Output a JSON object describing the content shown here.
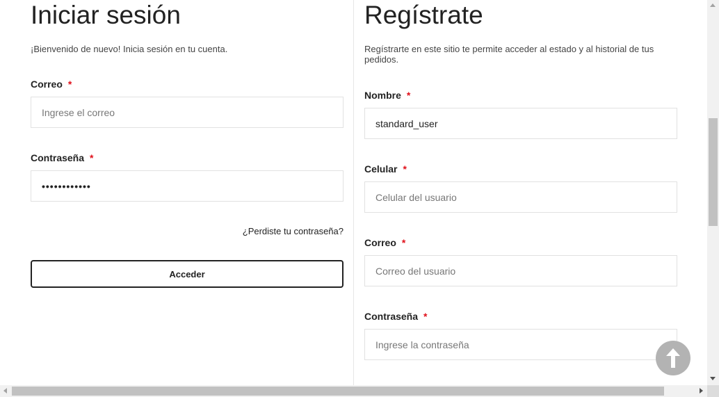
{
  "login": {
    "title": "Iniciar sesión",
    "subtitle": "¡Bienvenido de nuevo! Inicia sesión en tu cuenta.",
    "email_label": "Correo",
    "email_placeholder": "Ingrese el correo",
    "password_label": "Contraseña",
    "password_value": "••••••••••••",
    "forgot_link": "¿Perdiste tu contraseña?",
    "submit_label": "Acceder"
  },
  "register": {
    "title": "Regístrate",
    "subtitle": "Regístrarte en este sitio te permite acceder al estado y al historial de tus pedidos.",
    "name_label": "Nombre",
    "name_value": "standard_user",
    "phone_label": "Celular",
    "phone_placeholder": "Celular del usuario",
    "email_label": "Correo",
    "email_placeholder": "Correo del usuario",
    "password_label": "Contraseña",
    "password_placeholder": "Ingrese la contraseña"
  },
  "required_mark": "*",
  "icons": {
    "scroll_top": "arrow-up-icon"
  },
  "colors": {
    "required": "#e0101a",
    "button_border": "#222222",
    "scroll_top_bg": "#b3b3b3"
  }
}
